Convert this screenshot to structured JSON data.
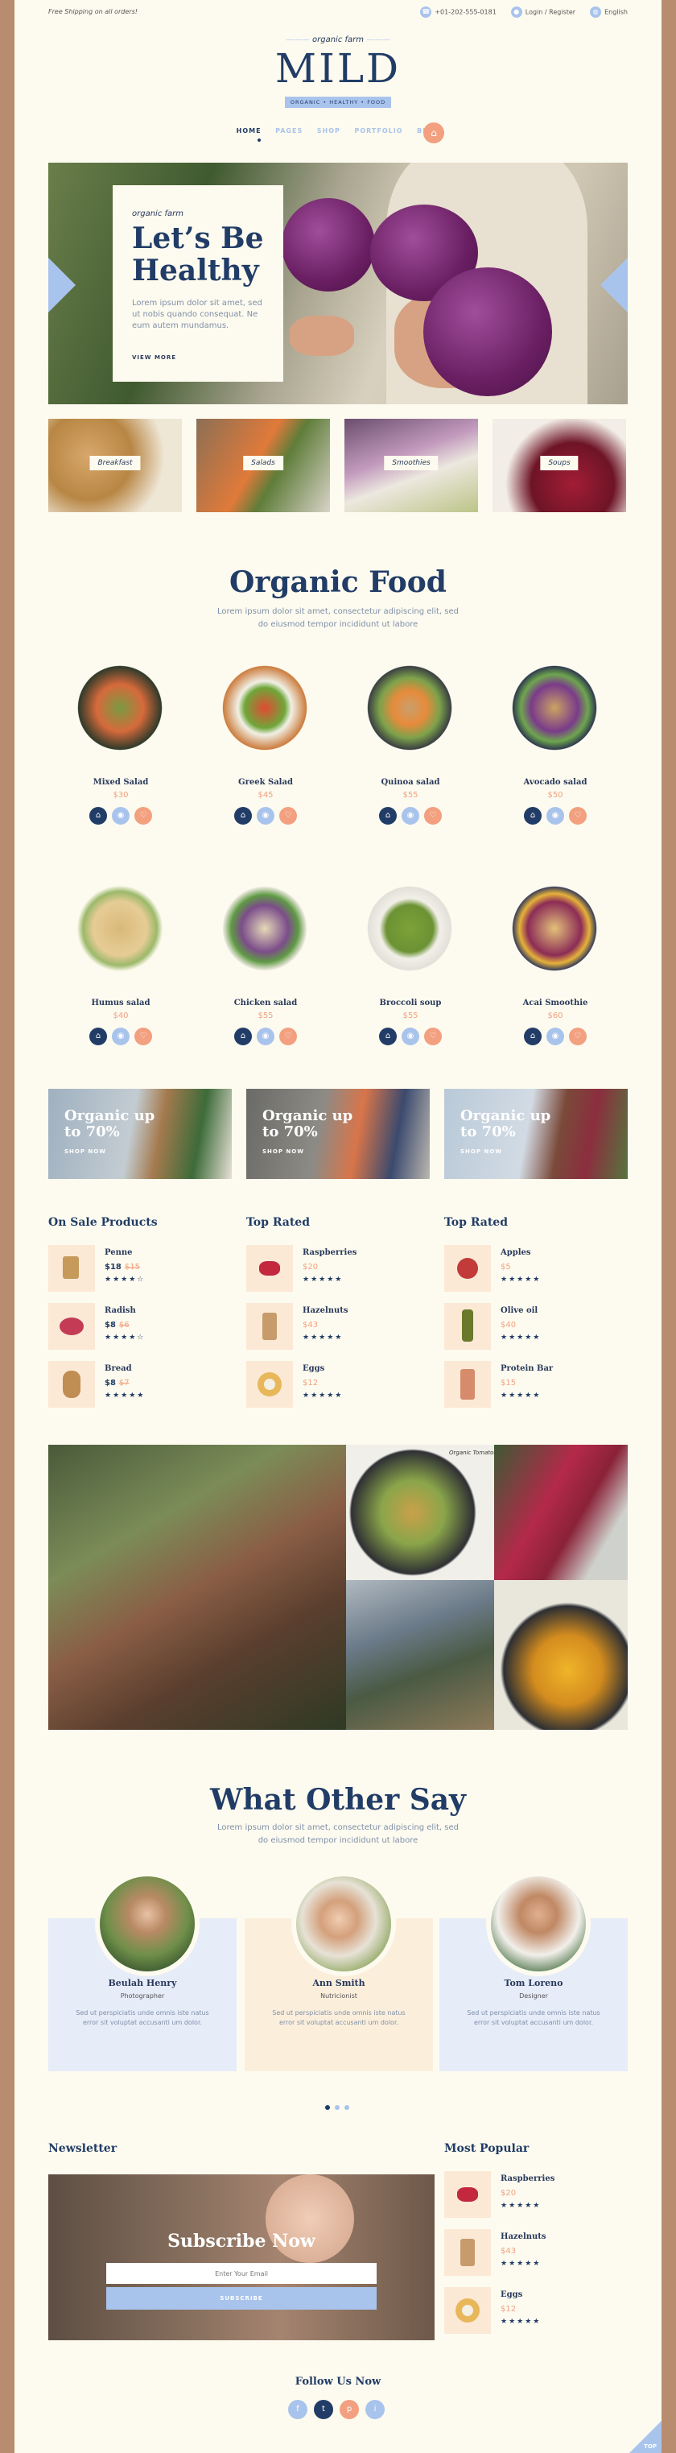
{
  "topbar": {
    "shipping": "Free Shipping on all orders!",
    "phone": "+01-202-555-0181",
    "login": "Login / Register",
    "language": "English"
  },
  "logo": {
    "tagline": "organic farm",
    "name": "MILD",
    "ribbon": "ORGANIC • HEALTHY • FOOD"
  },
  "nav": {
    "items": [
      "HOME",
      "PAGES",
      "SHOP",
      "PORTFOLIO",
      "BLOG"
    ],
    "active": "HOME"
  },
  "hero": {
    "script": "organic farm",
    "title_line1": "Let’s Be",
    "title_line2": "Healthy",
    "text": "Lorem ipsum dolor sit amet, sed ut nobis quando consequat. Ne eum autem mundamus.",
    "cta": "VIEW MORE"
  },
  "categories": [
    "Breakfast",
    "Salads",
    "Smoothies",
    "Soups"
  ],
  "organic": {
    "title": "Organic Food",
    "subtitle_line1": "Lorem ipsum dolor sit amet, consectetur adipiscing elit, sed",
    "subtitle_line2": "do eiusmod tempor incididunt ut labore"
  },
  "products": [
    {
      "name": "Mixed Salad",
      "price": "$30"
    },
    {
      "name": "Greek Salad",
      "price": "$45"
    },
    {
      "name": "Quinoa salad",
      "price": "$55"
    },
    {
      "name": "Avocado salad",
      "price": "$50"
    },
    {
      "name": "Humus salad",
      "price": "$40"
    },
    {
      "name": "Chicken salad",
      "price": "$55"
    },
    {
      "name": "Broccoli soup",
      "price": "$55"
    },
    {
      "name": "Acai Smoothie",
      "price": "$60"
    }
  ],
  "banners": [
    {
      "title_line1": "Organic up",
      "title_line2": "to 70%",
      "cta": "SHOP NOW"
    },
    {
      "title_line1": "Organic up",
      "title_line2": "to 70%",
      "cta": "SHOP NOW"
    },
    {
      "title_line1": "Organic up",
      "title_line2": "to 70%",
      "cta": "SHOP NOW"
    }
  ],
  "lists": {
    "onsale": {
      "title": "On Sale Products",
      "items": [
        {
          "name": "Penne",
          "price": "$18",
          "old": "$15",
          "stars": "★★★★☆"
        },
        {
          "name": "Radish",
          "price": "$8",
          "old": "$6",
          "stars": "★★★★☆"
        },
        {
          "name": "Bread",
          "price": "$8",
          "old": "$7",
          "stars": "★★★★★"
        }
      ]
    },
    "toprated1": {
      "title": "Top Rated",
      "items": [
        {
          "name": "Raspberries",
          "price": "$20",
          "stars": "★★★★★"
        },
        {
          "name": "Hazelnuts",
          "price": "$43",
          "stars": "★★★★★"
        },
        {
          "name": "Eggs",
          "price": "$12",
          "stars": "★★★★★"
        }
      ]
    },
    "toprated2": {
      "title": "Top Rated",
      "items": [
        {
          "name": "Apples",
          "price": "$5",
          "stars": "★★★★★"
        },
        {
          "name": "Olive oil",
          "price": "$40",
          "stars": "★★★★★"
        },
        {
          "name": "Protein Bar",
          "price": "$15",
          "stars": "★★★★★"
        }
      ]
    }
  },
  "gallery_sign": "Organic Tomatoes",
  "testimonials": {
    "title": "What Other Say",
    "subtitle_line1": "Lorem ipsum dolor sit amet, consectetur adipiscing elit, sed",
    "subtitle_line2": "do eiusmod tempor incididunt ut labore",
    "items": [
      {
        "name": "Beulah Henry",
        "role": "Photographer",
        "quote": "Sed ut perspiciatis unde omnis iste natus error sit voluptat accusanti um dolor."
      },
      {
        "name": "Ann Smith",
        "role": "Nutricionist",
        "quote": "Sed ut perspiciatis unde omnis iste natus error sit voluptat accusanti um dolor."
      },
      {
        "name": "Tom Loreno",
        "role": "Designer",
        "quote": "Sed ut perspiciatis unde omnis iste natus error sit voluptat accusanti um dolor."
      }
    ]
  },
  "newsletter": {
    "title": "Newsletter",
    "heading": "Subscribe Now",
    "placeholder": "Enter Your Email",
    "button": "SUBSCRIBE"
  },
  "popular": {
    "title": "Most Popular",
    "items": [
      {
        "name": "Raspberries",
        "price": "$20",
        "stars": "★★★★★"
      },
      {
        "name": "Hazelnuts",
        "price": "$43",
        "stars": "★★★★★"
      },
      {
        "name": "Eggs",
        "price": "$12",
        "stars": "★★★★★"
      }
    ]
  },
  "follow": {
    "title": "Follow Us Now",
    "icons": [
      "f",
      "t",
      "p",
      "i"
    ]
  },
  "totop": "TOP",
  "colors": {
    "navy": "#213c66",
    "blue": "#a9c4ec",
    "peach": "#f2a07f",
    "cream": "#fdfbef",
    "pale": "#fbe9d5"
  }
}
